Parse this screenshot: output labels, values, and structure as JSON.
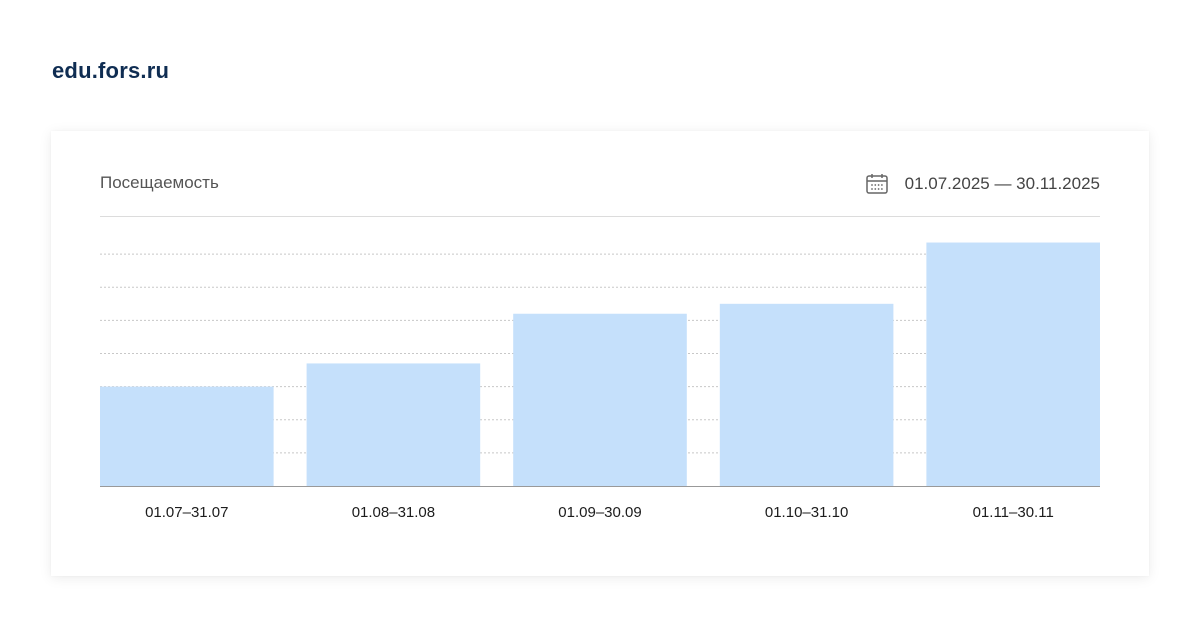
{
  "site": {
    "logo_text": "edu.fors.ru"
  },
  "card": {
    "title": "Посещаемость",
    "date_range": "01.07.2025 — 30.11.2025",
    "calendar_icon": "calendar-icon"
  },
  "colors": {
    "bar": "#c5e0fb",
    "grid": "#c8c8c8",
    "axis": "#999999",
    "label": "#1c1c1c",
    "brand": "#0f2d52"
  },
  "chart_data": {
    "type": "bar",
    "categories": [
      "01.07–31.07",
      "01.08–31.08",
      "01.09–30.09",
      "01.10–31.10",
      "01.11–30.11"
    ],
    "values": [
      3.0,
      3.7,
      5.2,
      5.5,
      7.35
    ],
    "ylim": [
      0,
      8
    ],
    "grid": true,
    "y_ticks_visible": false,
    "legend": "none"
  }
}
